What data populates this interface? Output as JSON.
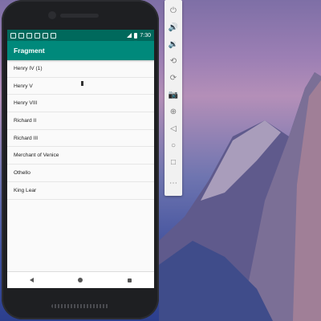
{
  "app": {
    "toolbar_title": "Fragment",
    "status_time": "7:30"
  },
  "list": {
    "items": [
      {
        "label": "Henry IV (1)"
      },
      {
        "label": "Henry V"
      },
      {
        "label": "Henry VIII"
      },
      {
        "label": "Richard II"
      },
      {
        "label": "Richard III"
      },
      {
        "label": "Merchant of Venice"
      },
      {
        "label": "Othello"
      },
      {
        "label": "King Lear"
      }
    ]
  },
  "emulator_toolbar": {
    "buttons": [
      {
        "icon": "power-icon",
        "glyph": "⏻"
      },
      {
        "icon": "volume-up-icon",
        "glyph": "🔊"
      },
      {
        "icon": "volume-down-icon",
        "glyph": "🔉"
      },
      {
        "icon": "rotate-left-icon",
        "glyph": "⟲"
      },
      {
        "icon": "rotate-right-icon",
        "glyph": "⟳"
      },
      {
        "icon": "camera-icon",
        "glyph": "📷"
      },
      {
        "icon": "zoom-icon",
        "glyph": "⊕"
      },
      {
        "icon": "back-icon",
        "glyph": "◁"
      },
      {
        "icon": "home-icon",
        "glyph": "○"
      },
      {
        "icon": "overview-icon",
        "glyph": "□"
      },
      {
        "icon": "more-icon",
        "glyph": "⋯"
      }
    ]
  },
  "colors": {
    "status_bar": "#00695c",
    "toolbar": "#00897b",
    "list_background": "#fafafa"
  }
}
